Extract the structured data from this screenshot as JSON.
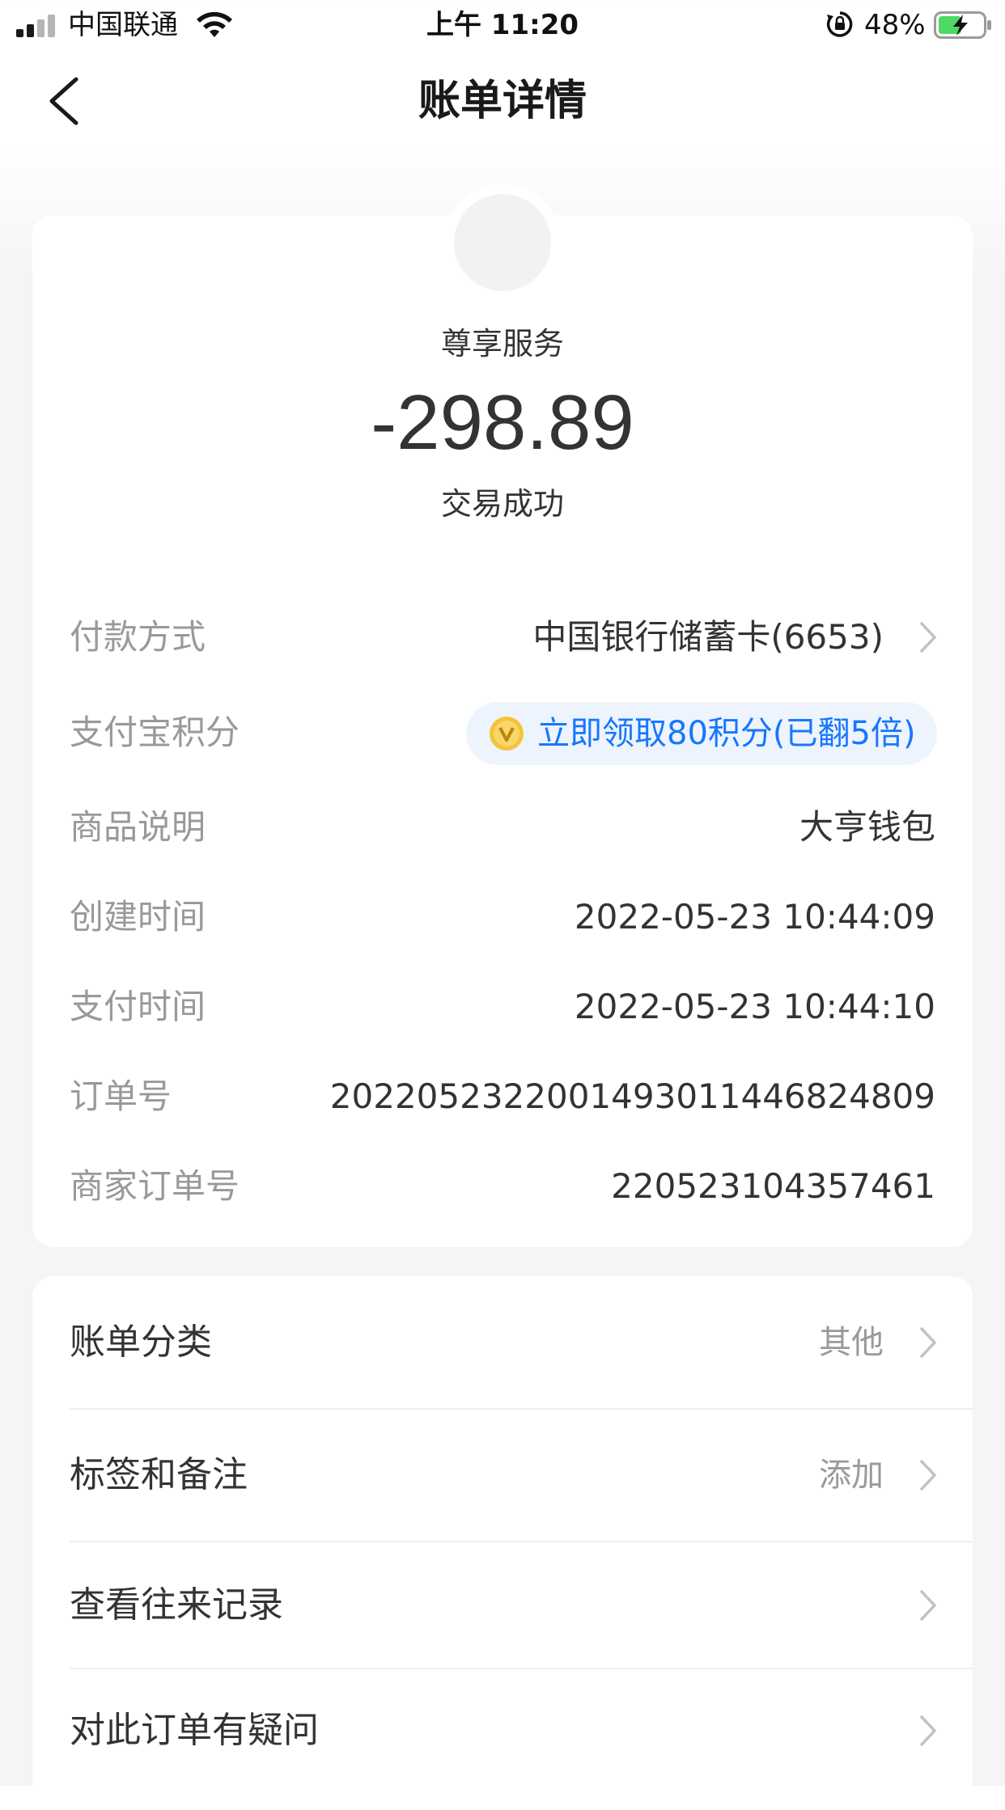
{
  "status_bar": {
    "carrier": "中国联通",
    "time": "上午 11:20",
    "battery": "48%"
  },
  "nav": {
    "title": "账单详情"
  },
  "summary": {
    "merchant": "尊享服务",
    "amount": "-298.89",
    "status": "交易成功"
  },
  "details": {
    "payment_method": {
      "label": "付款方式",
      "value": "中国银行储蓄卡(6653)"
    },
    "points": {
      "label": "支付宝积分",
      "value": "立即领取80积分(已翻5倍)"
    },
    "product": {
      "label": "商品说明",
      "value": "大亨钱包"
    },
    "created": {
      "label": "创建时间",
      "value": "2022-05-23 10:44:09"
    },
    "paid": {
      "label": "支付时间",
      "value": "2022-05-23 10:44:10"
    },
    "order_no": {
      "label": "订单号",
      "value": "2022052322001493011446824809"
    },
    "merchant_order_no": {
      "label": "商家订单号",
      "value": "220523104357461"
    }
  },
  "actions": {
    "category": {
      "label": "账单分类",
      "value": "其他"
    },
    "tags": {
      "label": "标签和备注",
      "value": "添加"
    },
    "history": {
      "label": "查看往来记录"
    },
    "question": {
      "label": "对此订单有疑问"
    }
  },
  "colors": {
    "accent": "#1677ff",
    "label_gray": "#999999",
    "text": "#333333",
    "background": "#f5f5f5"
  },
  "icons": [
    "back-icon",
    "chevron-right-icon",
    "points-coin-icon",
    "wifi-icon",
    "signal-icon",
    "battery-icon",
    "rotation-lock-icon"
  ]
}
